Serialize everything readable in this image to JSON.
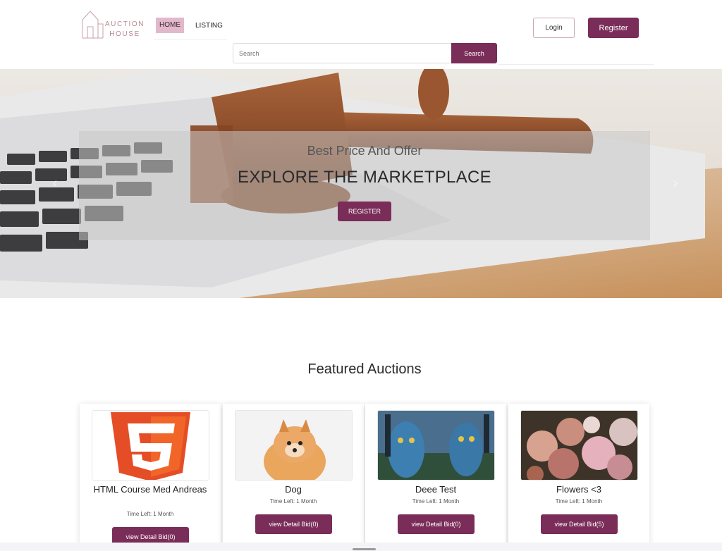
{
  "brand": {
    "name_line1": "AUCTION",
    "name_line2": "HOUSE",
    "accent": "#7a2d58",
    "nav_active_bg": "#e2b8cb"
  },
  "nav": {
    "home": "HOME",
    "listing": "LISTING"
  },
  "auth": {
    "login": "Login",
    "register": "Register"
  },
  "search": {
    "placeholder": "Search",
    "button": "Search"
  },
  "hero": {
    "subtitle": "Best Price And Offer",
    "title": "EXPLORE THE MARKETPLACE",
    "button": "REGISTER",
    "prev_icon": "chevron-left-icon",
    "next_icon": "chevron-right-icon"
  },
  "featured": {
    "title": "Featured Auctions",
    "cards": [
      {
        "name": "HTML Course Med Andreas",
        "time": "Time Left: 1 Month",
        "button": "view Detail Bid(0)",
        "image": "html5-logo"
      },
      {
        "name": "Dog",
        "time": "Time Left: 1 Month",
        "button": "view Detail Bid(0)",
        "image": "pomeranian-photo"
      },
      {
        "name": "Deee Test",
        "time": "Time Left: 1 Month",
        "button": "view Detail Bid(0)",
        "image": "avatar-movie-photo"
      },
      {
        "name": "Flowers <3",
        "time": "Time Left: 1 Month",
        "button": "view Detail Bid(5)",
        "image": "flowers-photo"
      }
    ]
  }
}
